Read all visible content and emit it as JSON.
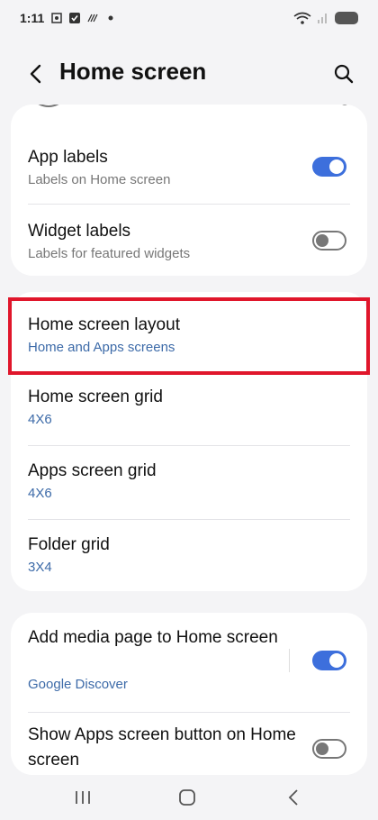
{
  "status_bar": {
    "time": "1:11"
  },
  "header": {
    "title": "Home screen"
  },
  "card_top": {
    "rows": [
      {
        "title": "App labels",
        "subtitle": "Labels on Home screen",
        "toggle": "on"
      },
      {
        "title": "Widget labels",
        "subtitle": "Labels for featured widgets",
        "toggle": "off"
      }
    ]
  },
  "card_layout": {
    "rows": [
      {
        "title": "Home screen layout",
        "value": "Home and Apps screens"
      },
      {
        "title": "Home screen grid",
        "value": "4X6"
      },
      {
        "title": "Apps screen grid",
        "value": "4X6"
      },
      {
        "title": "Folder grid",
        "value": "3X4"
      }
    ]
  },
  "card_media": {
    "rows": [
      {
        "title": "Add media page to Home screen",
        "value": "Google Discover",
        "toggle": "on"
      },
      {
        "title": "Show Apps screen button on Home screen",
        "toggle": "off"
      }
    ]
  },
  "colors": {
    "accent": "#3d6fdc",
    "highlight": "#e0162b",
    "value_blue": "#3c6aa8"
  }
}
